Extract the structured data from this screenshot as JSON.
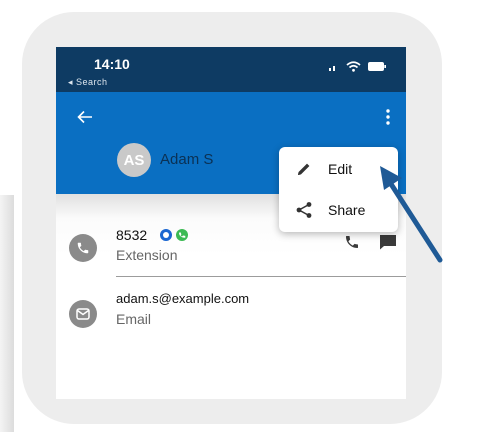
{
  "status_bar": {
    "time": "14:10",
    "back_label": "◂ Search"
  },
  "header": {
    "avatar_initials": "AS",
    "contact_name": "Adam S"
  },
  "menu": {
    "items": [
      {
        "label": "Edit",
        "icon": "pencil-icon"
      },
      {
        "label": "Share",
        "icon": "share-icon"
      }
    ]
  },
  "details": {
    "extension": {
      "value": "8532",
      "label": "Extension"
    },
    "email": {
      "value": "adam.s@example.com",
      "label": "Email"
    }
  },
  "colors": {
    "status_bar": "#0e3b63",
    "header": "#0a6fc2",
    "annotation_arrow": "#1f5a96",
    "presence_blue": "#1a66d1",
    "presence_green": "#3cba54"
  }
}
